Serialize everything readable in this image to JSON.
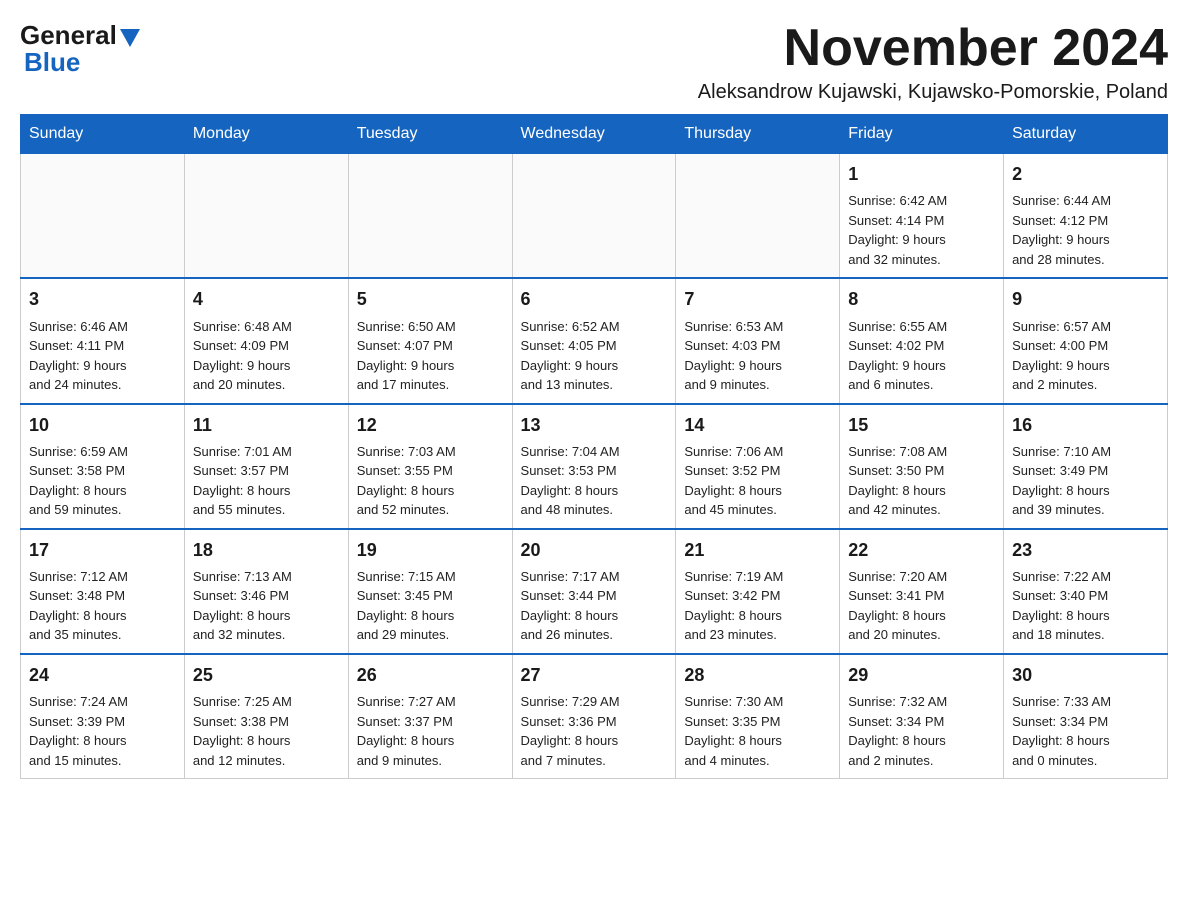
{
  "logo": {
    "line1": "General",
    "line2": "Blue"
  },
  "title": "November 2024",
  "location": "Aleksandrow Kujawski, Kujawsko-Pomorskie, Poland",
  "days_of_week": [
    "Sunday",
    "Monday",
    "Tuesday",
    "Wednesday",
    "Thursday",
    "Friday",
    "Saturday"
  ],
  "weeks": [
    [
      {
        "day": "",
        "info": ""
      },
      {
        "day": "",
        "info": ""
      },
      {
        "day": "",
        "info": ""
      },
      {
        "day": "",
        "info": ""
      },
      {
        "day": "",
        "info": ""
      },
      {
        "day": "1",
        "info": "Sunrise: 6:42 AM\nSunset: 4:14 PM\nDaylight: 9 hours\nand 32 minutes."
      },
      {
        "day": "2",
        "info": "Sunrise: 6:44 AM\nSunset: 4:12 PM\nDaylight: 9 hours\nand 28 minutes."
      }
    ],
    [
      {
        "day": "3",
        "info": "Sunrise: 6:46 AM\nSunset: 4:11 PM\nDaylight: 9 hours\nand 24 minutes."
      },
      {
        "day": "4",
        "info": "Sunrise: 6:48 AM\nSunset: 4:09 PM\nDaylight: 9 hours\nand 20 minutes."
      },
      {
        "day": "5",
        "info": "Sunrise: 6:50 AM\nSunset: 4:07 PM\nDaylight: 9 hours\nand 17 minutes."
      },
      {
        "day": "6",
        "info": "Sunrise: 6:52 AM\nSunset: 4:05 PM\nDaylight: 9 hours\nand 13 minutes."
      },
      {
        "day": "7",
        "info": "Sunrise: 6:53 AM\nSunset: 4:03 PM\nDaylight: 9 hours\nand 9 minutes."
      },
      {
        "day": "8",
        "info": "Sunrise: 6:55 AM\nSunset: 4:02 PM\nDaylight: 9 hours\nand 6 minutes."
      },
      {
        "day": "9",
        "info": "Sunrise: 6:57 AM\nSunset: 4:00 PM\nDaylight: 9 hours\nand 2 minutes."
      }
    ],
    [
      {
        "day": "10",
        "info": "Sunrise: 6:59 AM\nSunset: 3:58 PM\nDaylight: 8 hours\nand 59 minutes."
      },
      {
        "day": "11",
        "info": "Sunrise: 7:01 AM\nSunset: 3:57 PM\nDaylight: 8 hours\nand 55 minutes."
      },
      {
        "day": "12",
        "info": "Sunrise: 7:03 AM\nSunset: 3:55 PM\nDaylight: 8 hours\nand 52 minutes."
      },
      {
        "day": "13",
        "info": "Sunrise: 7:04 AM\nSunset: 3:53 PM\nDaylight: 8 hours\nand 48 minutes."
      },
      {
        "day": "14",
        "info": "Sunrise: 7:06 AM\nSunset: 3:52 PM\nDaylight: 8 hours\nand 45 minutes."
      },
      {
        "day": "15",
        "info": "Sunrise: 7:08 AM\nSunset: 3:50 PM\nDaylight: 8 hours\nand 42 minutes."
      },
      {
        "day": "16",
        "info": "Sunrise: 7:10 AM\nSunset: 3:49 PM\nDaylight: 8 hours\nand 39 minutes."
      }
    ],
    [
      {
        "day": "17",
        "info": "Sunrise: 7:12 AM\nSunset: 3:48 PM\nDaylight: 8 hours\nand 35 minutes."
      },
      {
        "day": "18",
        "info": "Sunrise: 7:13 AM\nSunset: 3:46 PM\nDaylight: 8 hours\nand 32 minutes."
      },
      {
        "day": "19",
        "info": "Sunrise: 7:15 AM\nSunset: 3:45 PM\nDaylight: 8 hours\nand 29 minutes."
      },
      {
        "day": "20",
        "info": "Sunrise: 7:17 AM\nSunset: 3:44 PM\nDaylight: 8 hours\nand 26 minutes."
      },
      {
        "day": "21",
        "info": "Sunrise: 7:19 AM\nSunset: 3:42 PM\nDaylight: 8 hours\nand 23 minutes."
      },
      {
        "day": "22",
        "info": "Sunrise: 7:20 AM\nSunset: 3:41 PM\nDaylight: 8 hours\nand 20 minutes."
      },
      {
        "day": "23",
        "info": "Sunrise: 7:22 AM\nSunset: 3:40 PM\nDaylight: 8 hours\nand 18 minutes."
      }
    ],
    [
      {
        "day": "24",
        "info": "Sunrise: 7:24 AM\nSunset: 3:39 PM\nDaylight: 8 hours\nand 15 minutes."
      },
      {
        "day": "25",
        "info": "Sunrise: 7:25 AM\nSunset: 3:38 PM\nDaylight: 8 hours\nand 12 minutes."
      },
      {
        "day": "26",
        "info": "Sunrise: 7:27 AM\nSunset: 3:37 PM\nDaylight: 8 hours\nand 9 minutes."
      },
      {
        "day": "27",
        "info": "Sunrise: 7:29 AM\nSunset: 3:36 PM\nDaylight: 8 hours\nand 7 minutes."
      },
      {
        "day": "28",
        "info": "Sunrise: 7:30 AM\nSunset: 3:35 PM\nDaylight: 8 hours\nand 4 minutes."
      },
      {
        "day": "29",
        "info": "Sunrise: 7:32 AM\nSunset: 3:34 PM\nDaylight: 8 hours\nand 2 minutes."
      },
      {
        "day": "30",
        "info": "Sunrise: 7:33 AM\nSunset: 3:34 PM\nDaylight: 8 hours\nand 0 minutes."
      }
    ]
  ]
}
